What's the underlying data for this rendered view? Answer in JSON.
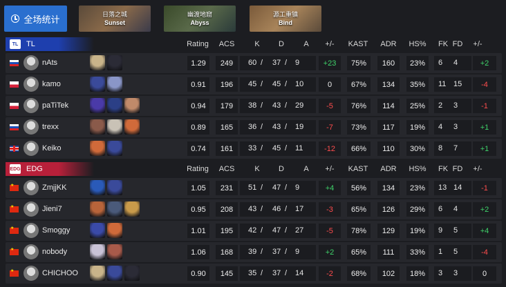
{
  "header": {
    "all_maps_label": "全场统计",
    "maps": [
      {
        "zh": "日落之城",
        "en": "Sunset"
      },
      {
        "zh": "幽渡地窟",
        "en": "Abyss"
      },
      {
        "zh": "源工重镇",
        "en": "Bind"
      }
    ]
  },
  "columns": {
    "rating": "Rating",
    "acs": "ACS",
    "k": "K",
    "d": "D",
    "a": "A",
    "kd_diff": "+/-",
    "kast": "KAST",
    "adr": "ADR",
    "hs": "HS%",
    "fk": "FK",
    "fd": "FD",
    "fk_diff": "+/-"
  },
  "teams": [
    {
      "name": "TL",
      "logo_text": "TL",
      "color": "#1e3fae",
      "players": [
        {
          "name": "nAts",
          "flag": "ru",
          "agents": [
            "#c9b48a",
            "#2b2b36"
          ],
          "rating": "1.29",
          "acs": "249",
          "k": "60",
          "d": "37",
          "a": "9",
          "kd_diff": "+23",
          "kd_sign": "pos",
          "kast": "75%",
          "adr": "160",
          "hs": "23%",
          "fk": "6",
          "fd": "4",
          "fk_diff": "+2",
          "fk_sign": "pos"
        },
        {
          "name": "kamo",
          "flag": "pl",
          "agents": [
            "#3a4a9a",
            "#8a96c8"
          ],
          "rating": "0.91",
          "acs": "196",
          "k": "45",
          "d": "45",
          "a": "10",
          "kd_diff": "0",
          "kd_sign": "zero",
          "kast": "67%",
          "adr": "134",
          "hs": "35%",
          "fk": "11",
          "fd": "15",
          "fk_diff": "-4",
          "fk_sign": "neg"
        },
        {
          "name": "paTiTek",
          "flag": "pl",
          "agents": [
            "#4a3aa8",
            "#2b3f86",
            "#c08a6a"
          ],
          "rating": "0.94",
          "acs": "179",
          "k": "38",
          "d": "43",
          "a": "29",
          "kd_diff": "-5",
          "kd_sign": "neg",
          "kast": "76%",
          "adr": "114",
          "hs": "25%",
          "fk": "2",
          "fd": "3",
          "fk_diff": "-1",
          "fk_sign": "neg"
        },
        {
          "name": "trexx",
          "flag": "ru",
          "agents": [
            "#8a5a4a",
            "#c9c2b6",
            "#d06a3a"
          ],
          "rating": "0.89",
          "acs": "165",
          "k": "36",
          "d": "43",
          "a": "19",
          "kd_diff": "-7",
          "kd_sign": "neg",
          "kast": "73%",
          "adr": "117",
          "hs": "19%",
          "fk": "4",
          "fd": "3",
          "fk_diff": "+1",
          "fk_sign": "pos"
        },
        {
          "name": "Keiko",
          "flag": "gb",
          "agents": [
            "#d06a3a",
            "#3a4a9a"
          ],
          "rating": "0.74",
          "acs": "161",
          "k": "33",
          "d": "45",
          "a": "11",
          "kd_diff": "-12",
          "kd_sign": "neg",
          "kast": "66%",
          "adr": "110",
          "hs": "30%",
          "fk": "8",
          "fd": "7",
          "fk_diff": "+1",
          "fk_sign": "pos"
        }
      ]
    },
    {
      "name": "EDG",
      "logo_text": "EDG",
      "color": "#b8203a",
      "players": [
        {
          "name": "ZmjjKK",
          "flag": "cn",
          "agents": [
            "#2a5ab8",
            "#3a4a9a"
          ],
          "rating": "1.05",
          "acs": "231",
          "k": "51",
          "d": "47",
          "a": "9",
          "kd_diff": "+4",
          "kd_sign": "pos",
          "kast": "56%",
          "adr": "134",
          "hs": "23%",
          "fk": "13",
          "fd": "14",
          "fk_diff": "-1",
          "fk_sign": "neg"
        },
        {
          "name": "Jieni7",
          "flag": "cn",
          "agents": [
            "#b8643a",
            "#4a5a7a",
            "#c89a4a"
          ],
          "rating": "0.95",
          "acs": "208",
          "k": "43",
          "d": "46",
          "a": "17",
          "kd_diff": "-3",
          "kd_sign": "neg",
          "kast": "65%",
          "adr": "126",
          "hs": "29%",
          "fk": "6",
          "fd": "4",
          "fk_diff": "+2",
          "fk_sign": "pos"
        },
        {
          "name": "Smoggy",
          "flag": "cn",
          "agents": [
            "#3a4aa8",
            "#d06a3a"
          ],
          "rating": "1.01",
          "acs": "195",
          "k": "42",
          "d": "47",
          "a": "27",
          "kd_diff": "-5",
          "kd_sign": "neg",
          "kast": "78%",
          "adr": "129",
          "hs": "19%",
          "fk": "9",
          "fd": "5",
          "fk_diff": "+4",
          "fk_sign": "pos"
        },
        {
          "name": "nobody",
          "flag": "cn",
          "agents": [
            "#c9c2d6",
            "#a85a4a"
          ],
          "rating": "1.06",
          "acs": "168",
          "k": "39",
          "d": "37",
          "a": "9",
          "kd_diff": "+2",
          "kd_sign": "pos",
          "kast": "65%",
          "adr": "111",
          "hs": "33%",
          "fk": "1",
          "fd": "5",
          "fk_diff": "-4",
          "fk_sign": "neg"
        },
        {
          "name": "CHICHOO",
          "flag": "cn",
          "agents": [
            "#c9b48a",
            "#3a4a9a",
            "#2b2b36"
          ],
          "rating": "0.90",
          "acs": "145",
          "k": "35",
          "d": "37",
          "a": "14",
          "kd_diff": "-2",
          "kd_sign": "neg",
          "kast": "68%",
          "adr": "102",
          "hs": "18%",
          "fk": "3",
          "fd": "3",
          "fk_diff": "0",
          "fk_sign": "zero"
        }
      ]
    }
  ]
}
